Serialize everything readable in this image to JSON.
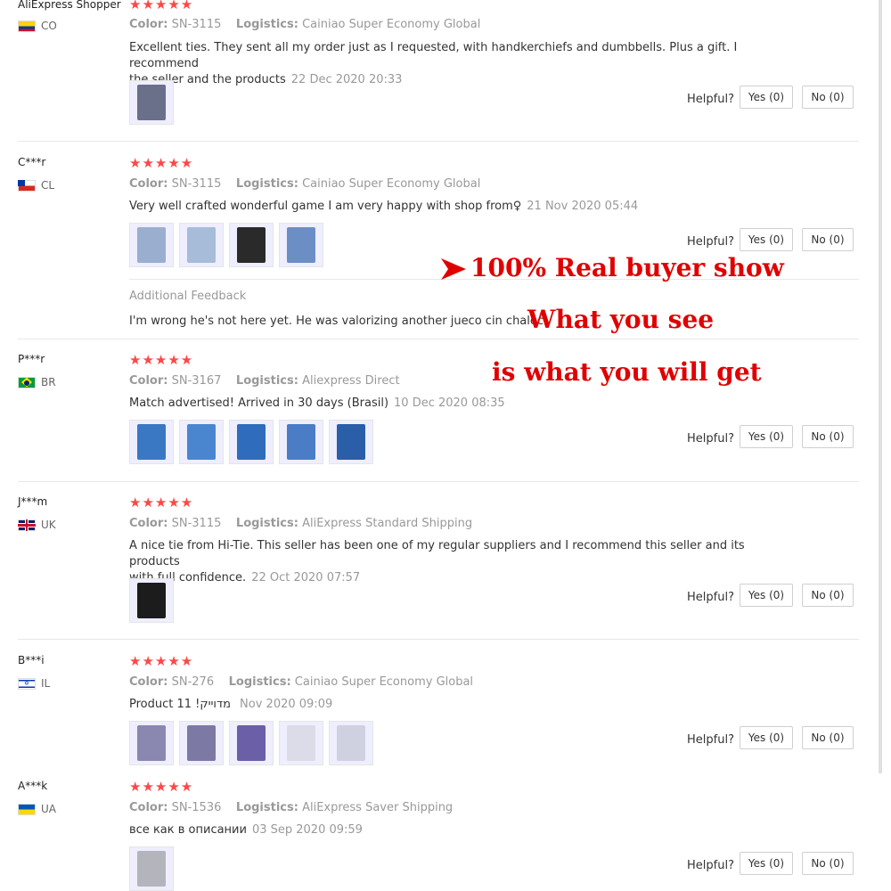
{
  "labels": {
    "color": "Color:",
    "logistics": "Logistics:",
    "helpful": "Helpful?",
    "yes": "Yes (0)",
    "no": "No (0)",
    "stars": "★★★★★"
  },
  "promo": {
    "line1": "100% Real buyer show",
    "line2": "What you see",
    "line3": "is what you will get"
  },
  "reviews": [
    {
      "user": "AliExpress Shopper",
      "country": "CO",
      "flag": "co-flag-icon",
      "color": "SN-3115",
      "logistics": "Cainiao Super Economy Global",
      "text_line1": "Excellent ties. They sent all my order just as I requested, with handkerchiefs and dumbbells. Plus a gift. I recommend",
      "text_line2": "the seller and the products",
      "date": "22 Dec 2020 20:33",
      "thumb_colors": [
        "#6a6f8a"
      ]
    },
    {
      "user": "C***r",
      "country": "CL",
      "flag": "cl-flag-icon",
      "color": "SN-3115",
      "logistics": "Cainiao Super Economy Global",
      "text_line1": "Very well crafted wonderful game I am very happy with shop from♀",
      "date": "21 Nov 2020 05:44",
      "thumb_colors": [
        "#9aaed0",
        "#a7bcd8",
        "#2a2a2a",
        "#6b8fc4"
      ],
      "additional_title": "Additional Feedback",
      "additional_text": "I'm wrong he's not here yet. He was valorizing another jueco cin chaleci."
    },
    {
      "user": "P***r",
      "country": "BR",
      "flag": "br-flag-icon",
      "color": "SN-3167",
      "logistics": "Aliexpress Direct",
      "text_line1": "Match advertised! Arrived in 30 days (Brasil)",
      "date": "10 Dec 2020 08:35",
      "thumb_colors": [
        "#3a78c4",
        "#4a86d0",
        "#2f6cbc",
        "#4a7dc6",
        "#2b5ea8"
      ]
    },
    {
      "user": "J***m",
      "country": "UK",
      "flag": "uk-flag-icon",
      "color": "SN-3115",
      "logistics": "AliExpress Standard Shipping",
      "text_line1": "A nice tie from Hi-Tie. This seller has been one of my regular suppliers and I recommend this seller and its products",
      "text_line2": "with full confidence.",
      "date": "22 Oct 2020 07:57",
      "thumb_colors": [
        "#1c1c1c"
      ]
    },
    {
      "user": "B***i",
      "country": "IL",
      "flag": "il-flag-icon",
      "color": "SN-276",
      "logistics": "Cainiao Super Economy Global",
      "text_line1": "Product  11 !מדוייק",
      "date": "Nov 2020 09:09",
      "thumb_colors": [
        "#8a88b0",
        "#7c7aa4",
        "#6b5fa8",
        "#dcdce8",
        "#cfd0e0"
      ]
    },
    {
      "user": "A***k",
      "country": "UA",
      "flag": "ua-flag-icon",
      "color": "SN-1536",
      "logistics": "AliExpress Saver Shipping",
      "text_line1": "все как в описании",
      "date": "03 Sep 2020 09:59",
      "thumb_colors": [
        "#b4b4bc"
      ]
    }
  ]
}
